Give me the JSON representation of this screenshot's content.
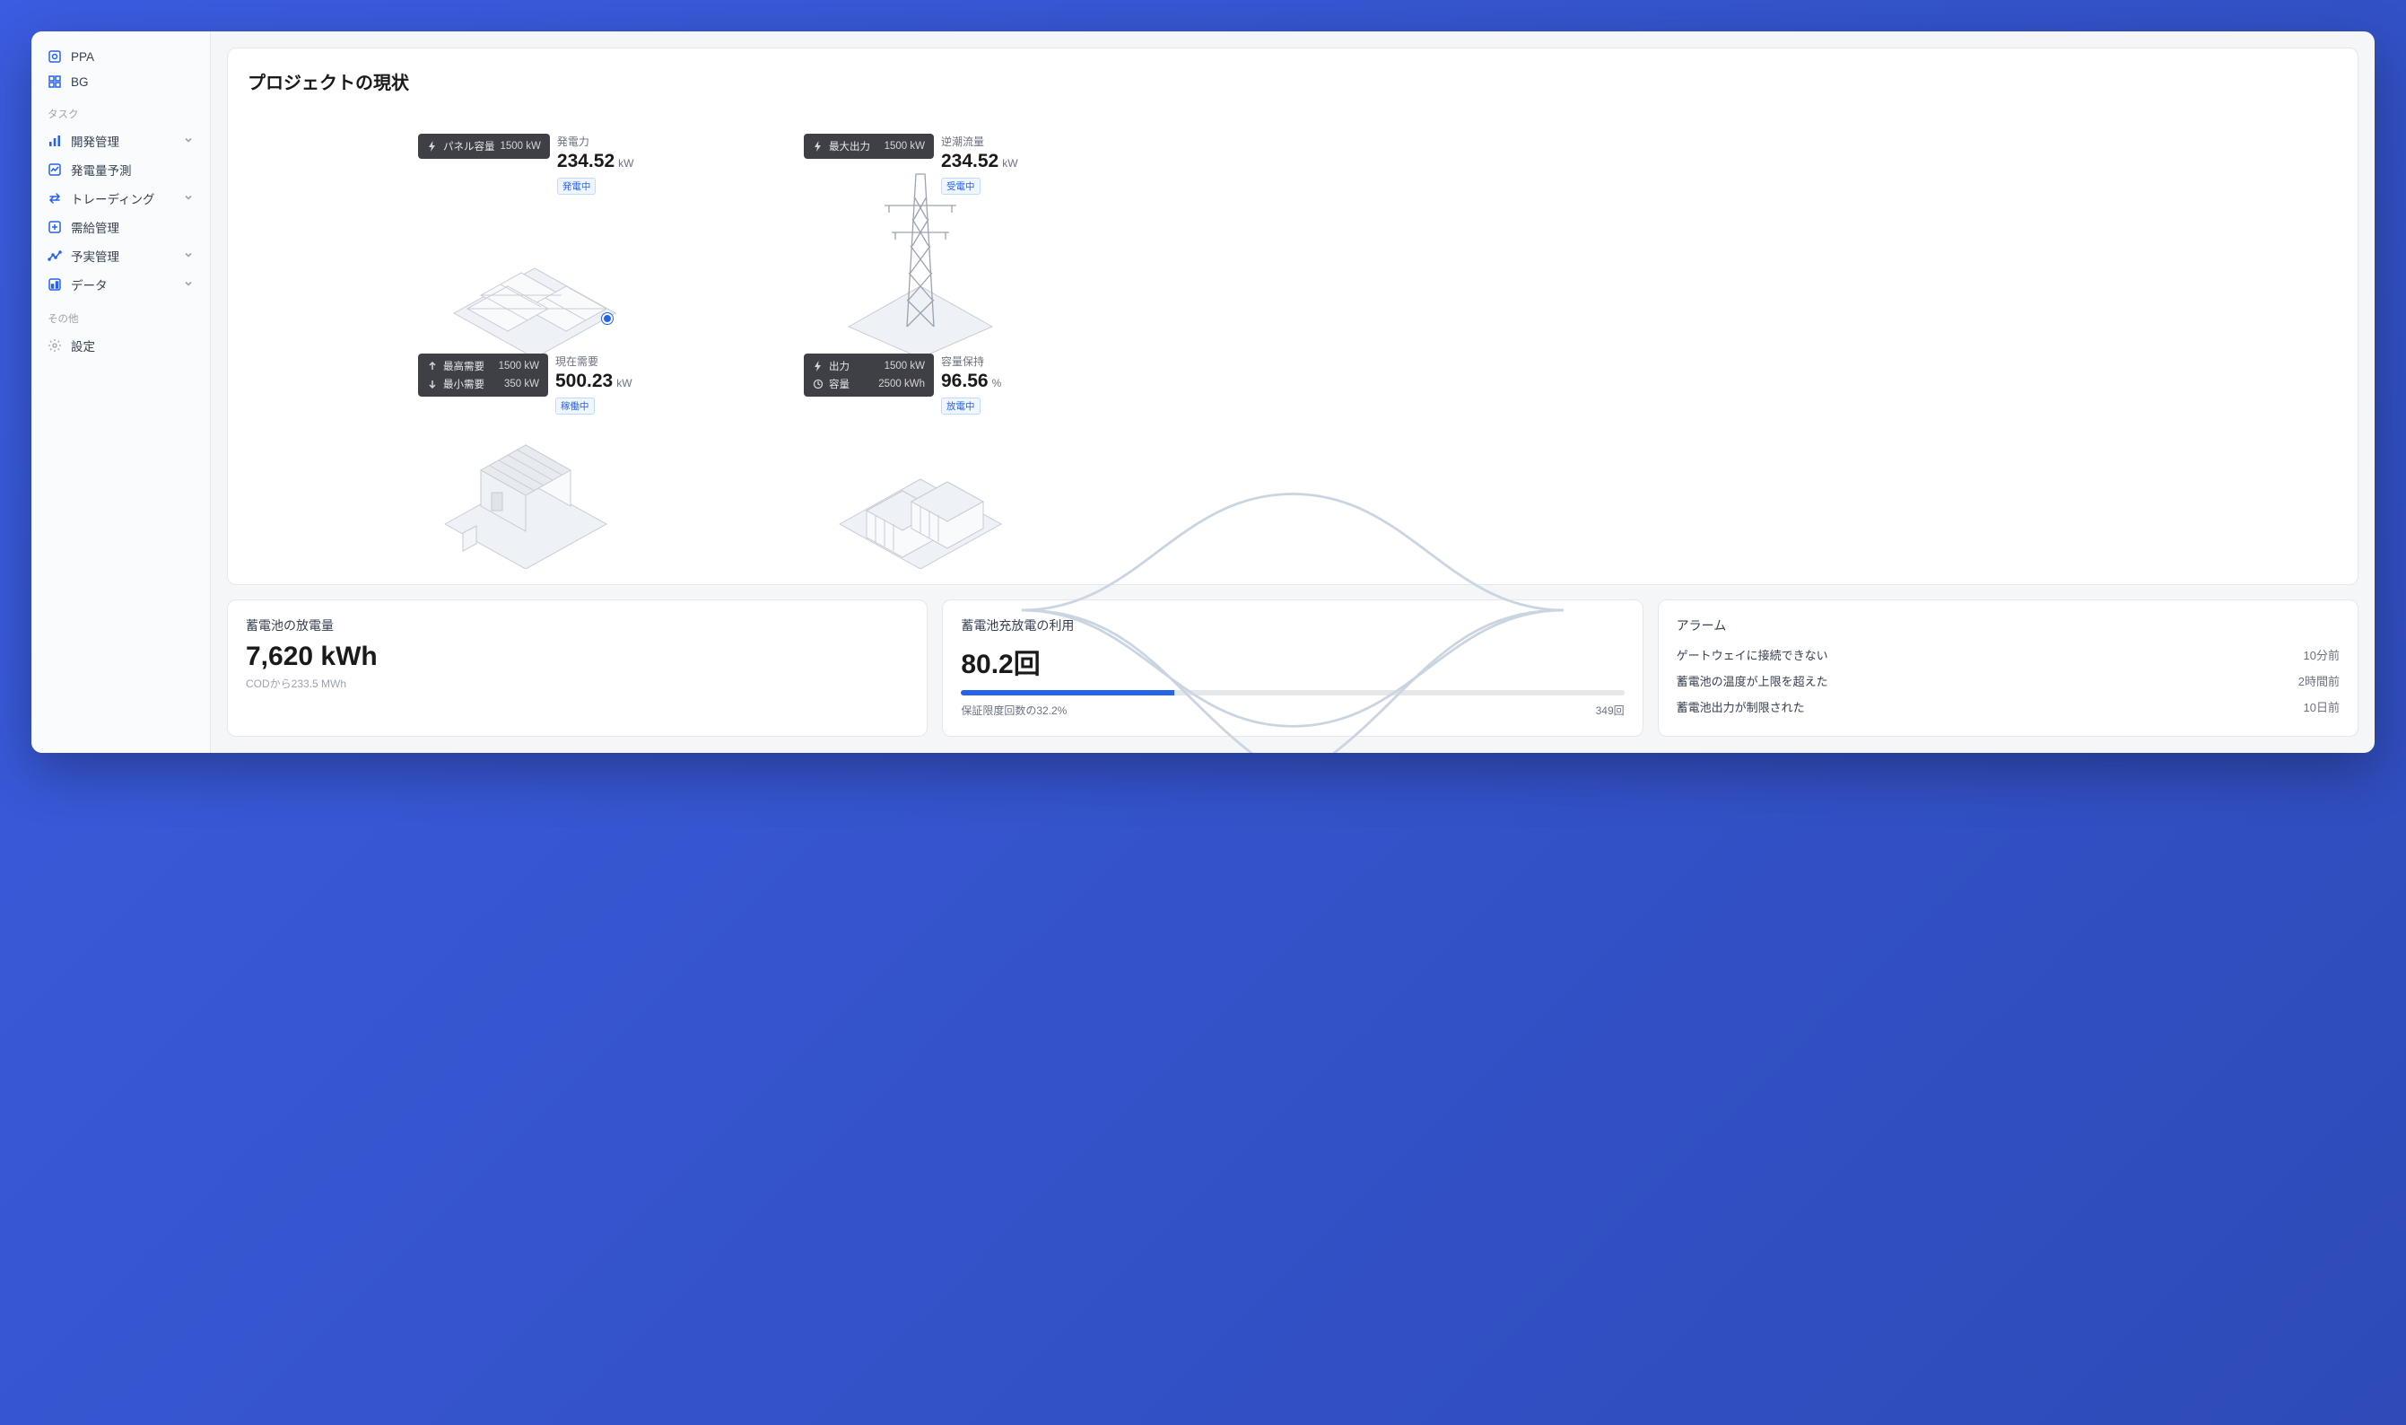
{
  "sidebar": {
    "top": [
      {
        "label": "PPA"
      },
      {
        "label": "BG"
      }
    ],
    "tasks_title": "タスク",
    "tasks": [
      {
        "label": "開発管理",
        "expandable": true
      },
      {
        "label": "発電量予測",
        "expandable": false
      },
      {
        "label": "トレーディング",
        "expandable": true
      },
      {
        "label": "需給管理",
        "expandable": false
      },
      {
        "label": "予実管理",
        "expandable": true
      },
      {
        "label": "データ",
        "expandable": true
      }
    ],
    "other_title": "その他",
    "other": [
      {
        "label": "設定"
      }
    ]
  },
  "diagram": {
    "title": "プロジェクトの現状",
    "panel": {
      "info_label": "パネル容量",
      "info_value": "1500 kW",
      "stat_label": "発電力",
      "stat_value": "234.52",
      "stat_unit": "kW",
      "badge": "発電中"
    },
    "tower": {
      "info_label": "最大出力",
      "info_value": "1500 kW",
      "stat_label": "逆潮流量",
      "stat_value": "234.52",
      "stat_unit": "kW",
      "badge": "受電中"
    },
    "house": {
      "info_label1": "最高需要",
      "info_value1": "1500 kW",
      "info_label2": "最小需要",
      "info_value2": "350 kW",
      "stat_label": "現在需要",
      "stat_value": "500.23",
      "stat_unit": "kW",
      "badge": "稼働中"
    },
    "battery": {
      "info_label1": "出力",
      "info_value1": "1500 kW",
      "info_label2": "容量",
      "info_value2": "2500 kWh",
      "stat_label": "容量保持",
      "stat_value": "96.56",
      "stat_unit": "%",
      "badge": "放電中"
    }
  },
  "bottom": {
    "discharge": {
      "title": "蓄電池の放電量",
      "value": "7,620 kWh",
      "sub": "CODから233.5 MWh"
    },
    "usage": {
      "title": "蓄電池充放電の利用",
      "value": "80.2回",
      "pct_text": "保証限度回数の32.2%",
      "count_text": "349回",
      "pct": 32.2
    },
    "alarms": {
      "title": "アラーム",
      "rows": [
        {
          "msg": "ゲートウェイに接続できない",
          "time": "10分前"
        },
        {
          "msg": "蓄電池の温度が上限を超えた",
          "time": "2時間前"
        },
        {
          "msg": "蓄電池出力が制限された",
          "time": "10日前"
        }
      ]
    }
  }
}
